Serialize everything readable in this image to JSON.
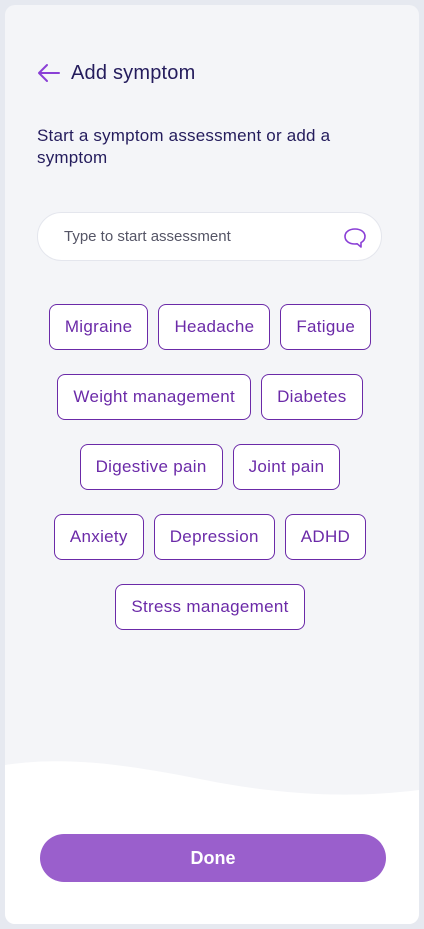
{
  "header": {
    "title": "Add symptom",
    "back_icon": "arrow-left-icon"
  },
  "subtitle": "Start a symptom assessment or add a symptom",
  "search": {
    "placeholder": "Type to start assessment",
    "value": "",
    "icon": "chat-bubble-icon"
  },
  "symptoms": [
    {
      "label": "Migraine"
    },
    {
      "label": "Headache"
    },
    {
      "label": "Fatigue"
    },
    {
      "label": "Weight management"
    },
    {
      "label": "Diabetes"
    },
    {
      "label": "Digestive pain"
    },
    {
      "label": "Joint pain"
    },
    {
      "label": "Anxiety"
    },
    {
      "label": "Depression"
    },
    {
      "label": "ADHD"
    },
    {
      "label": "Stress management"
    }
  ],
  "footer": {
    "done_label": "Done"
  },
  "colors": {
    "accent": "#6b2aa8",
    "button": "#9a5fcc",
    "title_text": "#241c5c",
    "background": "#f4f5f8"
  }
}
